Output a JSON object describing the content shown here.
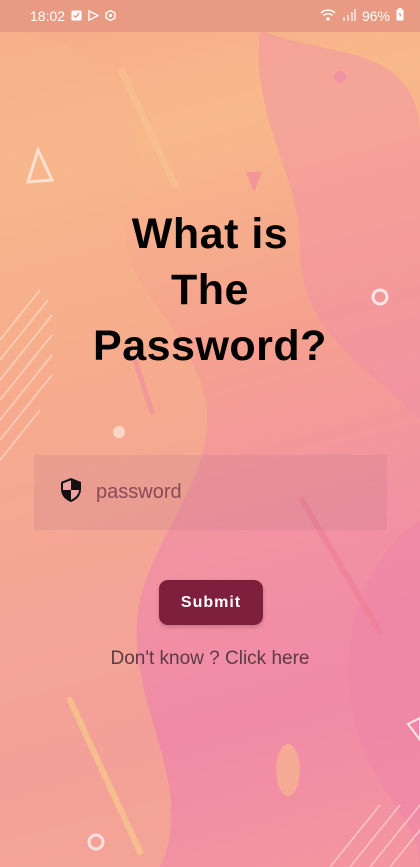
{
  "status_bar": {
    "time": "18:02",
    "battery": "96%"
  },
  "title": {
    "line1": "What is",
    "line2": "The",
    "line3": "Password?"
  },
  "password_field": {
    "placeholder": "password"
  },
  "submit": {
    "label": "Submit"
  },
  "help_link": {
    "label": "Don't know ? Click here"
  },
  "colors": {
    "button": "#7e1f3e",
    "status_bar": "#e89a82",
    "title_text": "#000000"
  }
}
